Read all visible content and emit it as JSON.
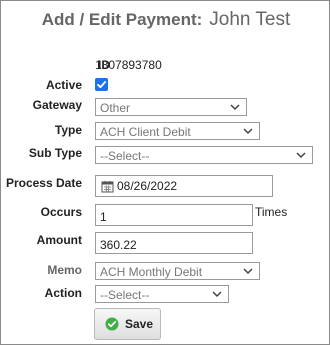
{
  "header": {
    "title": "Add / Edit Payment:",
    "customer_name": "John Test"
  },
  "fields": {
    "id": {
      "label": "ID",
      "value": "1307893780"
    },
    "active": {
      "label": "Active",
      "checked": true
    },
    "gateway": {
      "label": "Gateway",
      "value": "Other"
    },
    "type": {
      "label": "Type",
      "value": "ACH Client Debit"
    },
    "sub_type": {
      "label": "Sub Type",
      "value": "--Select--"
    },
    "process_date": {
      "label": "Process Date",
      "value": "08/26/2022"
    },
    "occurs": {
      "label": "Occurs",
      "value": "1",
      "suffix": "Times"
    },
    "amount": {
      "label": "Amount",
      "value": "360.22"
    },
    "memo": {
      "label": "Memo",
      "value": "ACH Monthly Debit"
    },
    "action": {
      "label": "Action",
      "value": "--Select--"
    }
  },
  "buttons": {
    "save_label": "Save"
  },
  "colors": {
    "accent": "#1a73e8",
    "ok_green": "#3cb043",
    "title_gray": "#666666"
  },
  "icons": {
    "calendar": "calendar-icon",
    "save": "check-circle-icon",
    "dropdown": "chevron-down-icon"
  }
}
